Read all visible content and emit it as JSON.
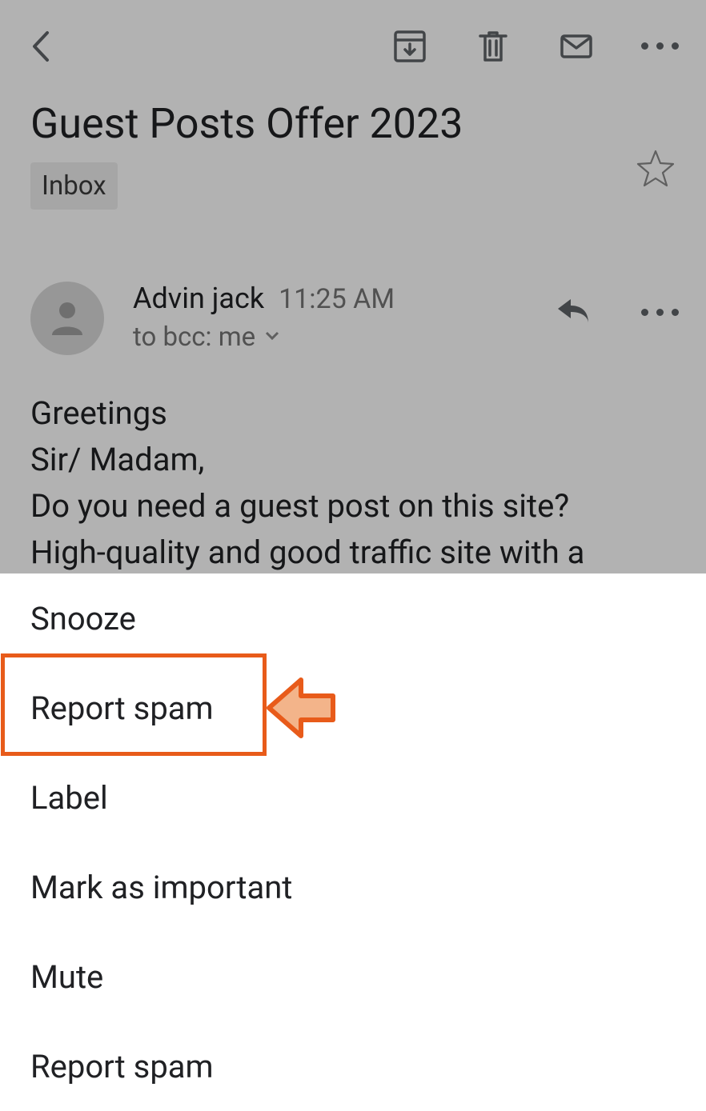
{
  "email": {
    "subject": "Guest Posts Offer 2023",
    "label": "Inbox",
    "sender": "Advin jack",
    "time": "11:25 AM",
    "recipient": "to bcc: me",
    "body_line1": "Greetings",
    "body_line2": " Sir/ Madam,",
    "body_line3": "Do you need a guest post on this site?",
    "body_line4": "High-quality and good traffic site with a"
  },
  "menu": {
    "items": [
      "Snooze",
      "Report spam",
      "Label",
      "Mark as important",
      "Mute",
      "Report spam"
    ]
  }
}
